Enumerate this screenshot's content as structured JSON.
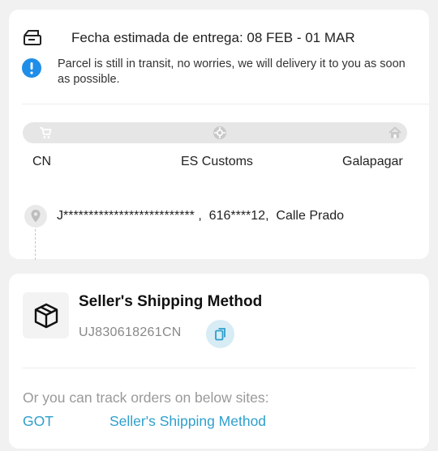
{
  "delivery": {
    "estimate_text": "Fecha estimada de entrega: 08 FEB - 01 MAR",
    "notice_text": "Parcel is still in transit, no worries, we will delivery it to you as soon as possible."
  },
  "tracking_progress": {
    "stages": [
      {
        "label": "CN",
        "icon": "cart-icon"
      },
      {
        "label": "ES Customs",
        "icon": "customs-icon"
      },
      {
        "label": "Galapagar",
        "icon": "home-icon"
      }
    ]
  },
  "address": {
    "text": "J************************** ,  616****12,  Calle Prado"
  },
  "shipping": {
    "method_title": "Seller's Shipping Method",
    "tracking_number": "UJ830618261CN",
    "copy_icon": "copy-icon"
  },
  "track_sites": {
    "prompt": "Or you can track orders on below sites:",
    "links": [
      "GOT",
      "Seller's Shipping Method"
    ]
  },
  "colors": {
    "accent": "#2e9fcc",
    "info_icon": "#1f8ee8",
    "page_bg": "#f1f1f1"
  }
}
